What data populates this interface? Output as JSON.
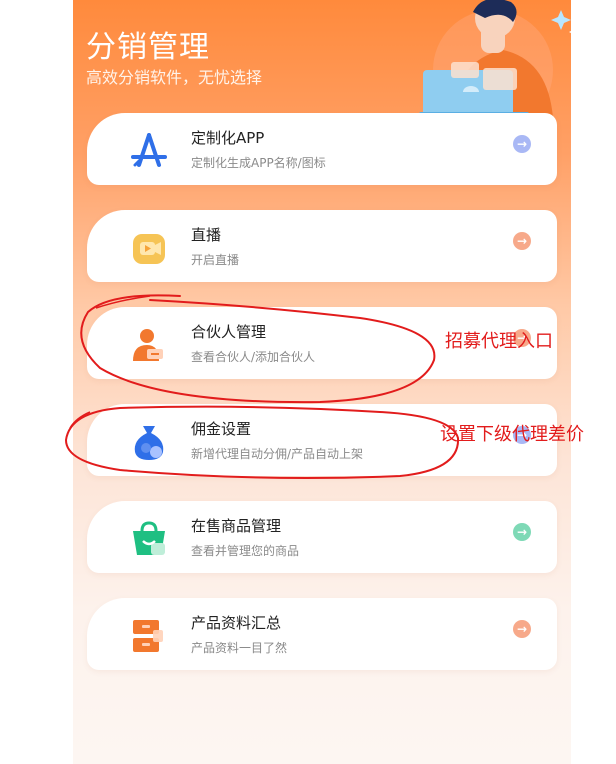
{
  "header": {
    "title": "分销管理",
    "subtitle": "高效分销软件，无忧选择"
  },
  "menu": [
    {
      "title": "定制化APP",
      "subtitle": "定制化生成APP名称/图标",
      "icon": "app-store-icon",
      "arrow_color": "#a9b8f5"
    },
    {
      "title": "直播",
      "subtitle": "开启直播",
      "icon": "live-video-icon",
      "arrow_color": "#f7a98a"
    },
    {
      "title": "合伙人管理",
      "subtitle": "查看合伙人/添加合伙人",
      "icon": "partner-icon",
      "arrow_color": "#f7a98a"
    },
    {
      "title": "佣金设置",
      "subtitle": "新增代理自动分佣/产品自动上架",
      "icon": "money-bag-icon",
      "arrow_color": "#a9b8f5"
    },
    {
      "title": "在售商品管理",
      "subtitle": "查看并管理您的商品",
      "icon": "shopping-bag-icon",
      "arrow_color": "#7ed9b6"
    },
    {
      "title": "产品资料汇总",
      "subtitle": "产品资料一目了然",
      "icon": "archive-icon",
      "arrow_color": "#f7a98a"
    }
  ],
  "annotations": [
    {
      "text": "招募代理入口"
    },
    {
      "text": "设置下级代理差价"
    }
  ],
  "colors": {
    "brand_orange": "#ff8a3c",
    "annotation_red": "#e21c1c"
  }
}
